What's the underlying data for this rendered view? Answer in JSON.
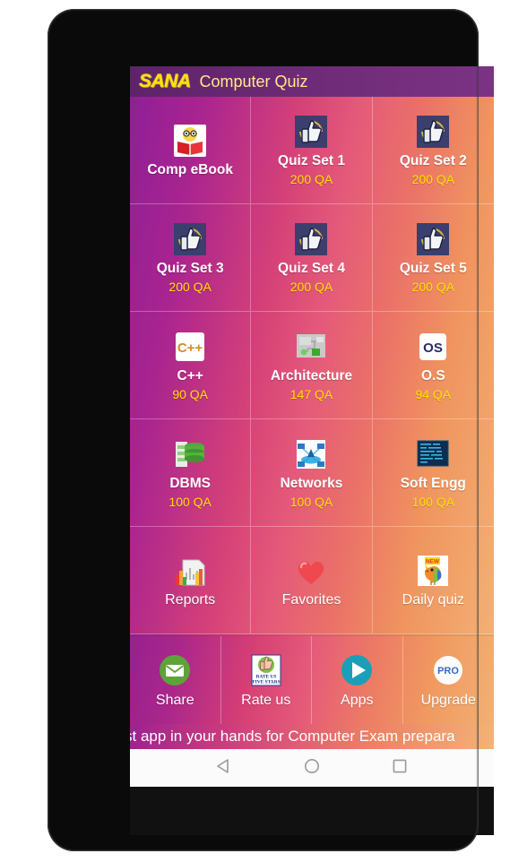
{
  "header": {
    "logo": "SANA",
    "title": "Computer Quiz"
  },
  "grid": {
    "tiles": [
      {
        "title": "Comp eBook",
        "qa": "",
        "icon": "book-reader-icon",
        "bold": true
      },
      {
        "title": "Quiz Set 1",
        "qa": "200 QA",
        "icon": "thumbs-up-icon",
        "bold": true
      },
      {
        "title": "Quiz Set 2",
        "qa": "200 QA",
        "icon": "thumbs-up-icon",
        "bold": true
      },
      {
        "title": "Quiz Set 3",
        "qa": "200 QA",
        "icon": "thumbs-up-icon",
        "bold": true
      },
      {
        "title": "Quiz Set 4",
        "qa": "200 QA",
        "icon": "thumbs-up-icon",
        "bold": true
      },
      {
        "title": "Quiz Set 5",
        "qa": "200 QA",
        "icon": "thumbs-up-icon",
        "bold": true
      },
      {
        "title": "C++",
        "qa": "90 QA",
        "icon": "cpp-icon",
        "bold": true
      },
      {
        "title": "Architecture",
        "qa": "147 QA",
        "icon": "architecture-icon",
        "bold": true
      },
      {
        "title": "O.S",
        "qa": "94 QA",
        "icon": "os-icon",
        "bold": true
      },
      {
        "title": "DBMS",
        "qa": "100 QA",
        "icon": "database-icon",
        "bold": true
      },
      {
        "title": "Networks",
        "qa": "100 QA",
        "icon": "network-icon",
        "bold": true
      },
      {
        "title": "Soft Engg",
        "qa": "100 QA",
        "icon": "code-screen-icon",
        "bold": true
      },
      {
        "title": "Reports",
        "qa": "",
        "icon": "report-chart-icon",
        "bold": false
      },
      {
        "title": "Favorites",
        "qa": "",
        "icon": "heart-icon",
        "bold": false
      },
      {
        "title": "Daily quiz",
        "qa": "",
        "icon": "new-bird-icon",
        "bold": false
      }
    ]
  },
  "bottom_bar": {
    "items": [
      {
        "label": "Share",
        "icon": "envelope-icon"
      },
      {
        "label": "Rate us",
        "icon": "rate-stars-icon",
        "badge_line1": "RATE US",
        "badge_line2": "FIVE STARS"
      },
      {
        "label": "Apps",
        "icon": "play-store-icon"
      },
      {
        "label": "Upgrade",
        "icon": "pro-badge-icon",
        "badge_text": "PRO"
      }
    ]
  },
  "marquee": {
    "text": "st app in your hands for Computer Exam prepara"
  },
  "navbar": {
    "back": "back-triangle-icon",
    "home": "home-circle-icon",
    "recents": "recents-square-icon"
  },
  "colors": {
    "gradient_start": "#8e1f97",
    "gradient_mid": "#e4597a",
    "gradient_end": "#f2b074",
    "header_bg": "#6d2a76",
    "logo_yellow": "#ffe000",
    "qa_yellow": "#ffe000"
  }
}
